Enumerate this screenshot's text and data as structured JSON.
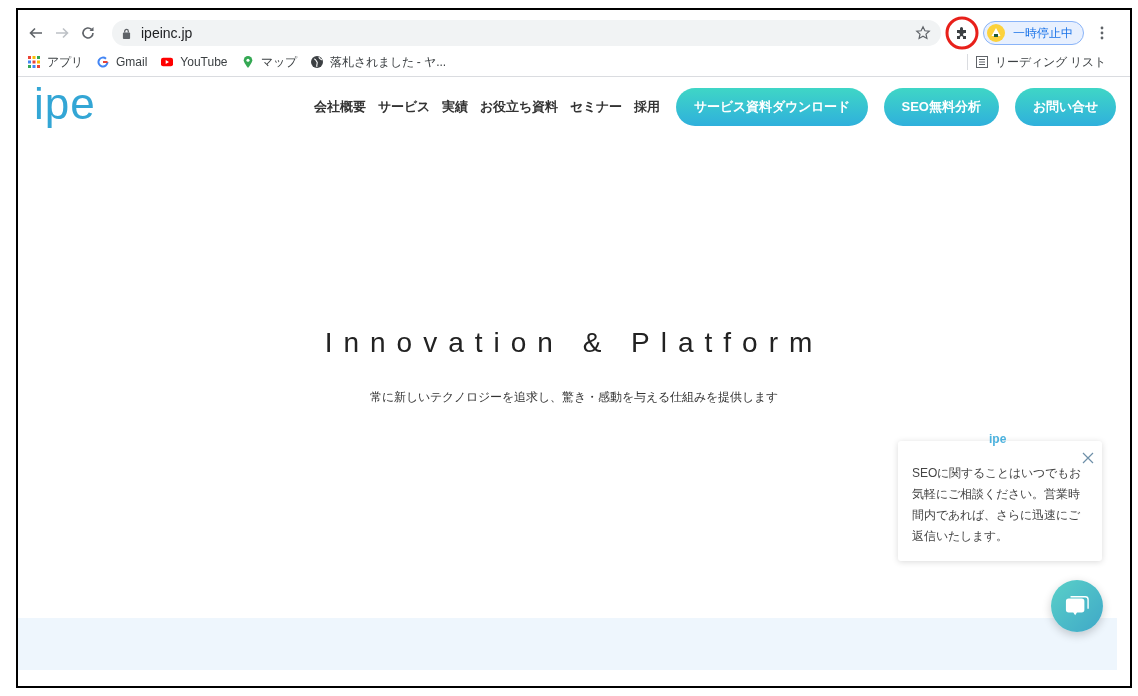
{
  "browser": {
    "url": "ipeinc.jp",
    "profile_button": "一時停止中",
    "extension_highlighted": true,
    "bookmarks": [
      {
        "kind": "apps",
        "label": "アプリ"
      },
      {
        "kind": "google",
        "label": "Gmail"
      },
      {
        "kind": "youtube",
        "label": "YouTube"
      },
      {
        "kind": "maps",
        "label": "マップ"
      },
      {
        "kind": "globe",
        "label": "落札されました - ヤ..."
      }
    ],
    "reading_list": "リーディング リスト"
  },
  "site": {
    "logo": "ipe",
    "nav": [
      "会社概要",
      "サービス",
      "実績",
      "お役立ち資料",
      "セミナー",
      "採用"
    ],
    "cta_buttons": [
      "サービス資料ダウンロード",
      "SEO無料分析",
      "お問い合せ"
    ]
  },
  "hero": {
    "title": "Innovation & Platform",
    "subtitle": "常に新しいテクノロジーを追求し、驚き・感動を与える仕組みを提供します"
  },
  "chat": {
    "brand": "ipe",
    "message": "SEOに関することはいつでもお気軽にご相談ください。営業時間内であれば、さらに迅速にご返信いたします。"
  }
}
